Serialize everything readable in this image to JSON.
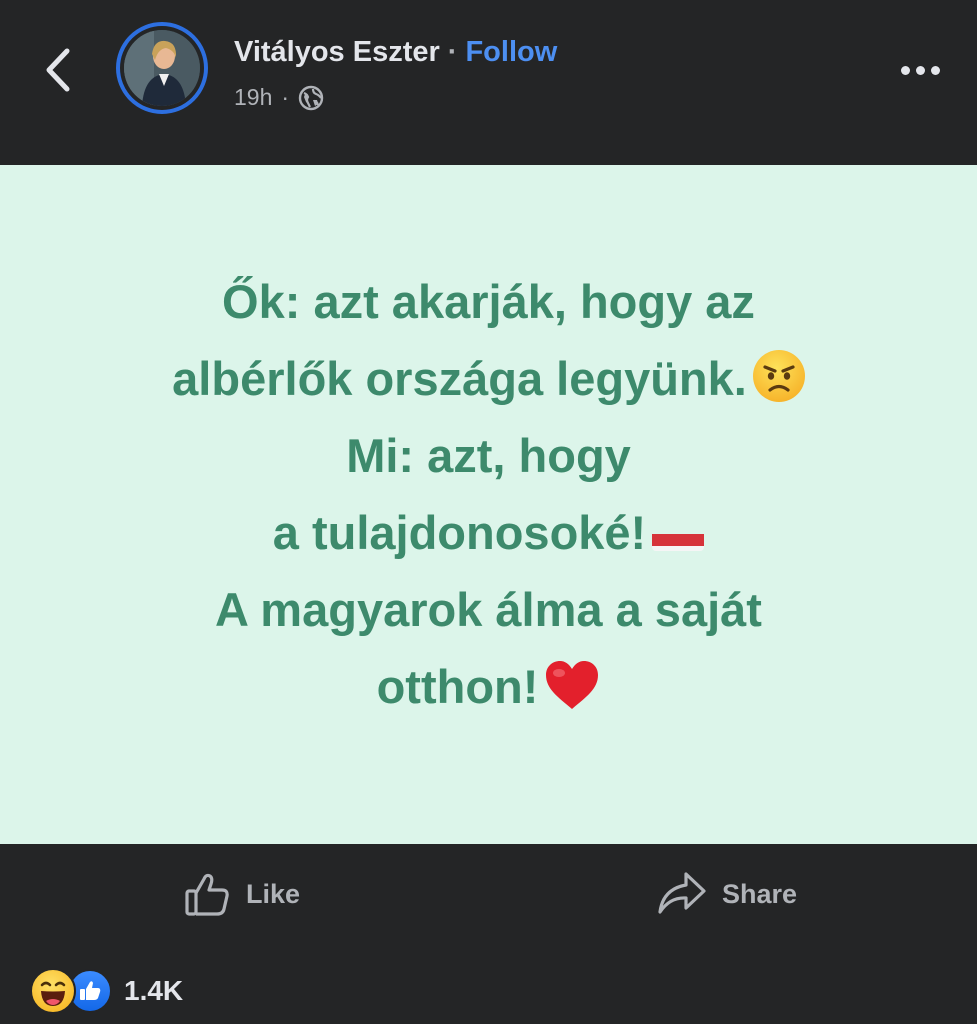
{
  "header": {
    "author_name": "Vitályos Eszter",
    "separator": "·",
    "follow_label": "Follow",
    "timestamp": "19h",
    "meta_separator": "·",
    "privacy_icon": "globe-icon",
    "back_icon": "chevron-left-icon",
    "more_icon": "more-horizontal-icon"
  },
  "post": {
    "background_color": "#dcf5ea",
    "text_color": "#3d8a6c",
    "lines": [
      "Ők: azt akarják, hogy az",
      "albérlők országa legyünk.",
      "Mi: azt, hogy",
      "a tulajdonosoké!",
      "A magyarok álma a saját",
      "otthon!"
    ],
    "emojis": {
      "line2": "angry-face-emoji",
      "line4": "hungary-flag-emoji",
      "line6": "red-heart-emoji"
    }
  },
  "actions": {
    "like_label": "Like",
    "share_label": "Share"
  },
  "reactions": {
    "icons": [
      "laughing-face-reaction",
      "thumbs-up-reaction"
    ],
    "count": "1.4K"
  },
  "colors": {
    "background": "#242526",
    "accent": "#4d8ff1",
    "avatar_ring": "#2d6fe0",
    "secondary_text": "#b0b3b8",
    "primary_text": "#e4e6eb"
  }
}
